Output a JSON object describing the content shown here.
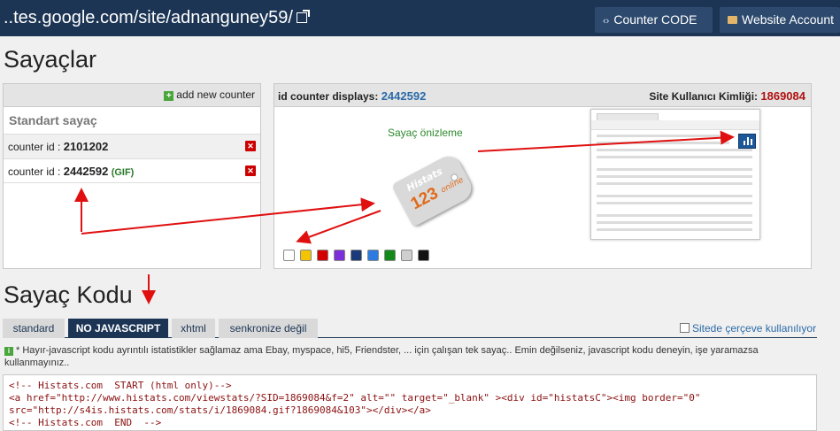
{
  "topbar": {
    "site_url": "..tes.google.com/site/adnanguney59/",
    "counter_code_label": "Counter CODE",
    "website_account_label": "Website Account",
    "counter_code_icon": "‹›"
  },
  "title_counters": "Sayaçlar",
  "left_panel": {
    "add_new_label": "add new counter",
    "standard_title": "Standart sayaç",
    "rows": [
      {
        "label": "counter id :",
        "id": "2101202",
        "tag": ""
      },
      {
        "label": "counter id :",
        "id": "2442592",
        "tag": "(GIF)"
      }
    ]
  },
  "right_panel": {
    "displays_label": "id counter displays:",
    "displays_id": "2442592",
    "user_id_label": "Site Kullanıcı Kimliği:",
    "user_id": "1869084",
    "preview_label": "Sayaç önizleme",
    "badge_brand": "Histats",
    "badge_number": "123",
    "badge_online": "online",
    "swatch_colors": [
      "#ffffff",
      "#f5c400",
      "#d40000",
      "#7a2fd8",
      "#1a3a7a",
      "#2e7be0",
      "#118a1a",
      "#cfcfcf",
      "#111111"
    ]
  },
  "title_code": "Sayaç Kodu",
  "tabs": [
    {
      "label": "standard",
      "active": false
    },
    {
      "label": "NO JAVASCRIPT",
      "active": true
    },
    {
      "label": "xhtml",
      "active": false
    },
    {
      "label": "senkronize değil",
      "active": false
    }
  ],
  "frame_option_label": "Sitede çerçeve kullanılıyor",
  "note_text": "* Hayır-javascript kodu ayrıntılı istatistikler sağlamaz ama Ebay, myspace, hi5, Friendster, ... için çalışan tek sayaç.. Emin değilseniz, javascript kodu deneyin, işe yaramazsa kullanmayınız..",
  "code_text": "<!-- Histats.com  START (html only)-->\n<a href=\"http://www.histats.com/viewstats/?SID=1869084&f=2\" alt=\"\" target=\"_blank\" ><div id=\"histatsC\"><img border=\"0\"\nsrc=\"http://s4is.histats.com/stats/i/1869084.gif?1869084&103\"></div></a>\n<!-- Histats.com  END  -->",
  "colors": {
    "topbar": "#1c3555",
    "accent_blue": "#2a6aa8",
    "accent_red": "#b01010",
    "green": "#2c8a2c"
  }
}
